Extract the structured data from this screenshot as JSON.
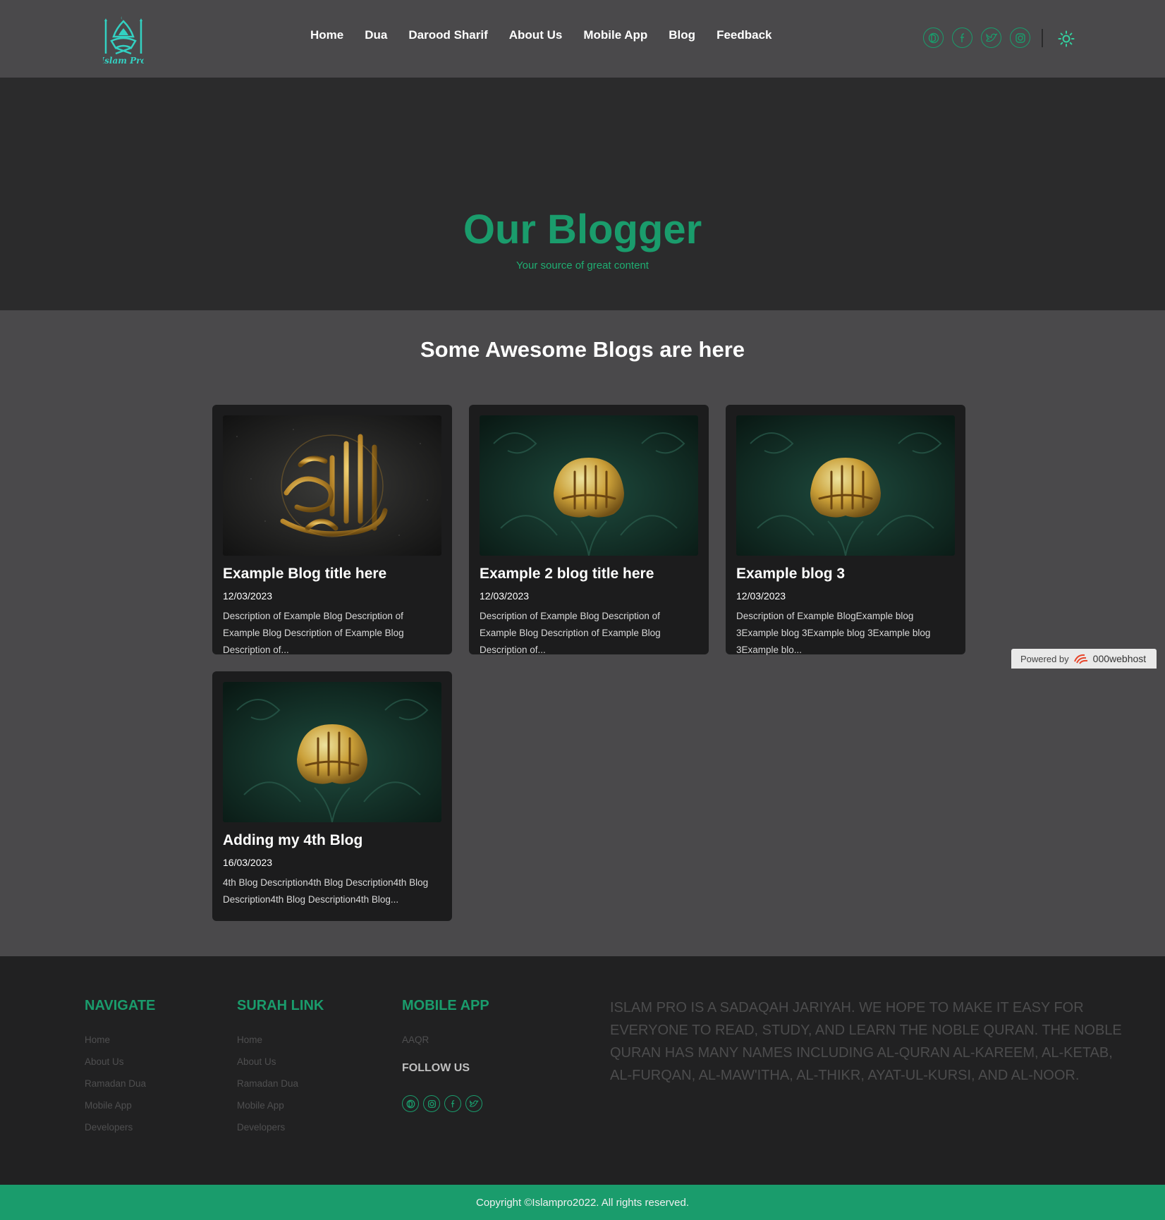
{
  "header": {
    "logo_text": "Islam Pro",
    "nav": [
      "Home",
      "Dua",
      "Darood Sharif",
      "About Us",
      "Mobile App",
      "Blog",
      "Feedback"
    ],
    "social_icons": [
      "dribbble-icon",
      "facebook-icon",
      "twitter-icon",
      "instagram-icon"
    ],
    "theme_toggle_icon": "sun-icon"
  },
  "hero": {
    "title": "Our Blogger",
    "subtitle": "Your source of great content"
  },
  "blogs": {
    "heading": "Some Awesome Blogs are here",
    "cards": [
      {
        "title": "Example Blog title here",
        "date": "12/03/2023",
        "description": "Description of Example Blog Description of Example Blog Description of Example Blog Description of...",
        "image": "arabic-calligraphy-gold-on-black"
      },
      {
        "title": "Example 2 blog title here",
        "date": "12/03/2023",
        "description": "Description of Example Blog Description of Example Blog Description of Example Blog Description of...",
        "image": "gold-calligraphy-on-green"
      },
      {
        "title": "Example blog 3",
        "date": "12/03/2023",
        "description": "Description of Example BlogExample blog 3Example blog 3Example blog 3Example blog 3Example blo...",
        "image": "gold-calligraphy-on-green"
      },
      {
        "title": "Adding my 4th Blog",
        "date": "16/03/2023",
        "description": "4th Blog Description4th Blog Description4th Blog Description4th Blog Description4th Blog...",
        "image": "gold-calligraphy-on-green"
      }
    ]
  },
  "powered_by": {
    "label": "Powered by",
    "brand": "000webhost"
  },
  "footer": {
    "navigate": {
      "title": "NAVIGATE",
      "links": [
        "Home",
        "About Us",
        "Ramadan Dua",
        "Mobile App",
        "Developers"
      ]
    },
    "surah_link": {
      "title": "SURAH LINK",
      "links": [
        "Home",
        "About Us",
        "Ramadan Dua",
        "Mobile App",
        "Developers"
      ]
    },
    "mobile_app": {
      "title": "MOBILE APP",
      "links": [
        "AAQR"
      ]
    },
    "follow_us": {
      "title": "FOLLOW US",
      "icons": [
        "dribbble-icon",
        "instagram-icon",
        "facebook-icon",
        "twitter-icon"
      ]
    },
    "about": "ISLAM PRO IS A SADAQAH JARIYAH. WE HOPE TO MAKE IT EASY FOR EVERYONE TO READ, STUDY, AND LEARN THE NOBLE QURAN. THE NOBLE QURAN HAS MANY NAMES INCLUDING AL-QURAN AL-KAREEM, AL-KETAB, AL-FURQAN, AL-MAW'ITHA, AL-THIKR, AYAT-UL-KURSI, AND AL-NOOR.",
    "copyright": "Copyright ©Islampro2022. All rights reserved."
  },
  "colors": {
    "accent": "#1a9c6c",
    "page_bg": "#4a494b",
    "hero_bg": "#2b2b2c",
    "card_bg": "#1c1c1d",
    "footer_bg": "#212122"
  }
}
